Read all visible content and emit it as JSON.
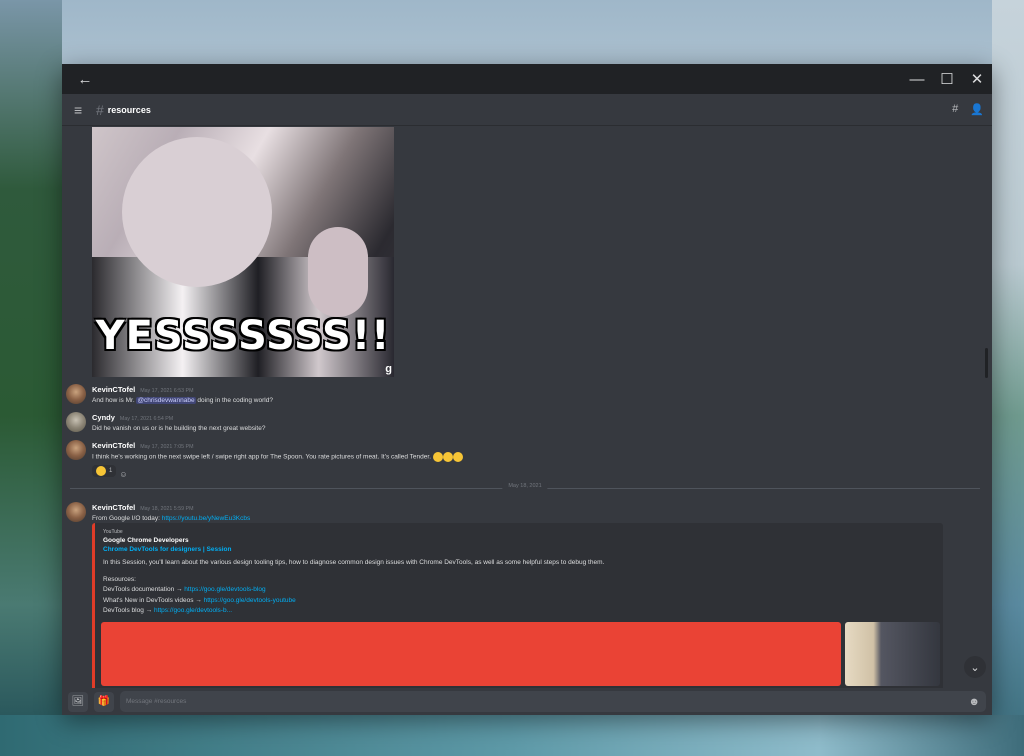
{
  "window": {
    "back_icon": "←",
    "min_icon": "—",
    "max_icon": "☐",
    "close_icon": "✕"
  },
  "channel": {
    "menu_icon": "≡",
    "hash": "#",
    "name": "resources",
    "threads_icon": "#",
    "members_icon": "👤"
  },
  "gif": {
    "caption": "YESSSSSSS!!",
    "mark": "g"
  },
  "messages": [
    {
      "author": "KevinCTofel",
      "timestamp": "May 17, 2021 6:53 PM",
      "text_before": "And how is Mr. ",
      "mention": "@chrisdevwannabe",
      "text_after": " doing in the coding world?"
    },
    {
      "author": "Cyndy",
      "timestamp": "May 17, 2021 6:54 PM",
      "text": "Did he vanish on us or is he building the next great website?"
    },
    {
      "author": "KevinCTofel",
      "timestamp": "May 17, 2021 7:05 PM",
      "text": "I think he's working on the next swipe left / swipe right app for The Spoon. You rate pictures of meat. It's called Tender.",
      "reaction_count": "1"
    },
    {
      "author": "KevinCTofel",
      "timestamp": "May 18, 2021 5:59 PM",
      "text": "From Google I/O today: ",
      "link": "https://youtu.be/yNewEu3Kcbs"
    }
  ],
  "divider_date": "May 18, 2021",
  "embed": {
    "provider": "YouTube",
    "author": "Google Chrome Developers",
    "title": "Chrome DevTools for designers | Session",
    "description": "In this Session, you'll learn about the various design tooling tips, how to diagnose common design issues with Chrome DevTools, as well as some helpful steps to debug them.",
    "resources_label": "Resources:",
    "res1_label": "DevTools documentation → ",
    "res1_link": "https://goo.gle/devtools-blog",
    "res2_label": "What's New in DevTools videos → ",
    "res2_link": "https://goo.gle/devtools-youtube",
    "res3_label": "DevTools blog → ",
    "res3_link": "https://goo.gle/devtools-b..."
  },
  "composer": {
    "placeholder": "Message #resources",
    "upload_icon": "🖼",
    "gift_icon": "🎁",
    "emoji_icon": "☻"
  },
  "scroll_icon": "⌄"
}
